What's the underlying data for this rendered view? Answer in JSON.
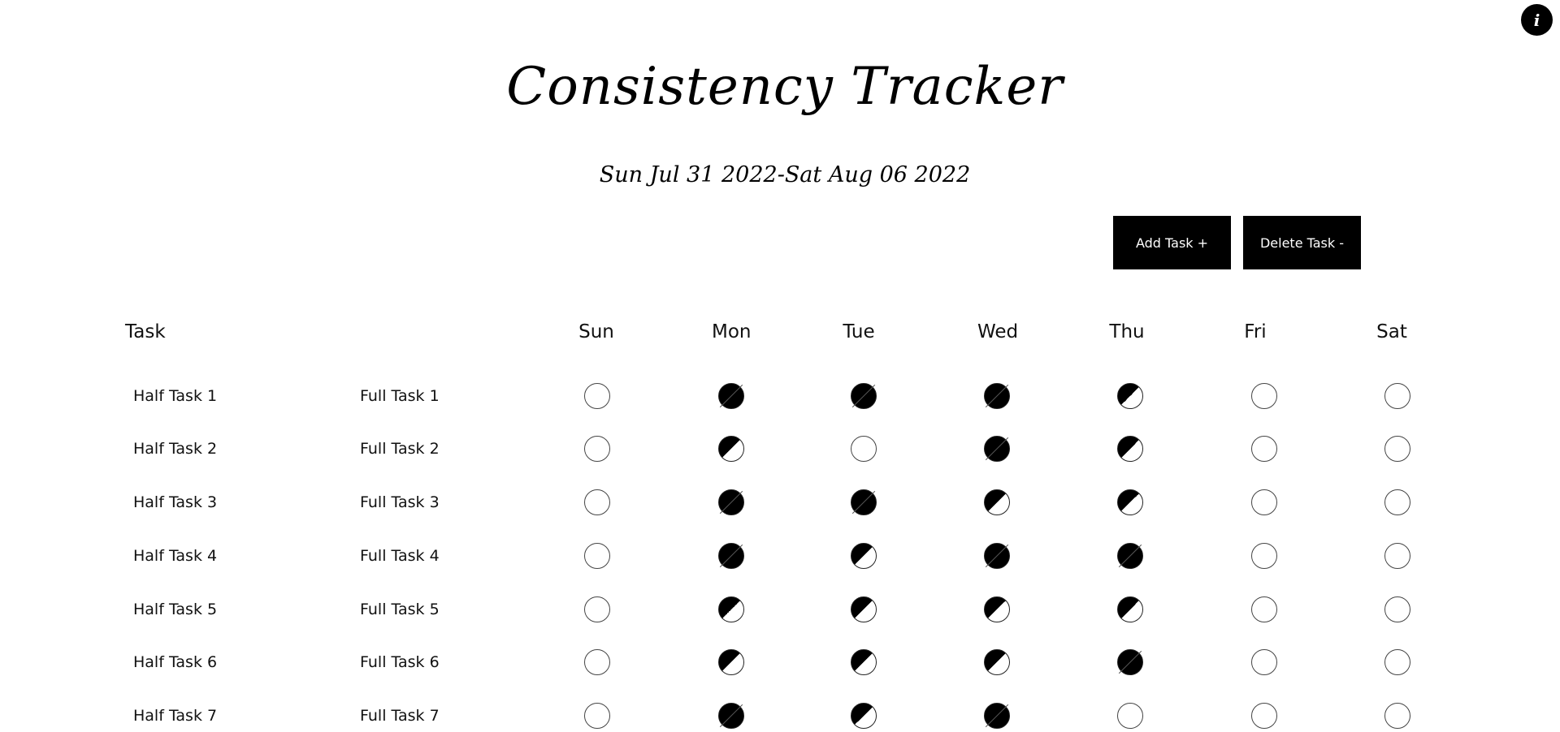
{
  "header": {
    "info_icon_glyph": "i",
    "title": "Consistency Tracker",
    "date_range": "Sun Jul 31 2022-Sat Aug 06 2022"
  },
  "actions": {
    "add_label": "Add Task +",
    "delete_label": "Delete Task -"
  },
  "table": {
    "task_header": "Task",
    "days": [
      "Sun",
      "Mon",
      "Tue",
      "Wed",
      "Thu",
      "Fri",
      "Sat"
    ],
    "rows": [
      {
        "half": "Half Task 1",
        "full": "Full Task 1",
        "status": [
          "empty",
          "full",
          "full",
          "full",
          "half",
          "empty",
          "empty"
        ]
      },
      {
        "half": "Half Task 2",
        "full": "Full Task 2",
        "status": [
          "empty",
          "half",
          "empty",
          "full",
          "half",
          "empty",
          "empty"
        ]
      },
      {
        "half": "Half Task 3",
        "full": "Full Task 3",
        "status": [
          "empty",
          "full",
          "full",
          "half",
          "half",
          "empty",
          "empty"
        ]
      },
      {
        "half": "Half Task 4",
        "full": "Full Task 4",
        "status": [
          "empty",
          "full",
          "half",
          "full",
          "full",
          "empty",
          "empty"
        ]
      },
      {
        "half": "Half Task 5",
        "full": "Full Task 5",
        "status": [
          "empty",
          "half",
          "half",
          "half",
          "half",
          "empty",
          "empty"
        ]
      },
      {
        "half": "Half Task 6",
        "full": "Full Task 6",
        "status": [
          "empty",
          "half",
          "half",
          "half",
          "full",
          "empty",
          "empty"
        ]
      },
      {
        "half": "Half Task 7",
        "full": "Full Task 7",
        "status": [
          "empty",
          "full",
          "half",
          "full",
          "empty",
          "empty",
          "empty"
        ]
      }
    ]
  },
  "colors": {
    "background": "#ffffff",
    "ink": "#000000"
  }
}
